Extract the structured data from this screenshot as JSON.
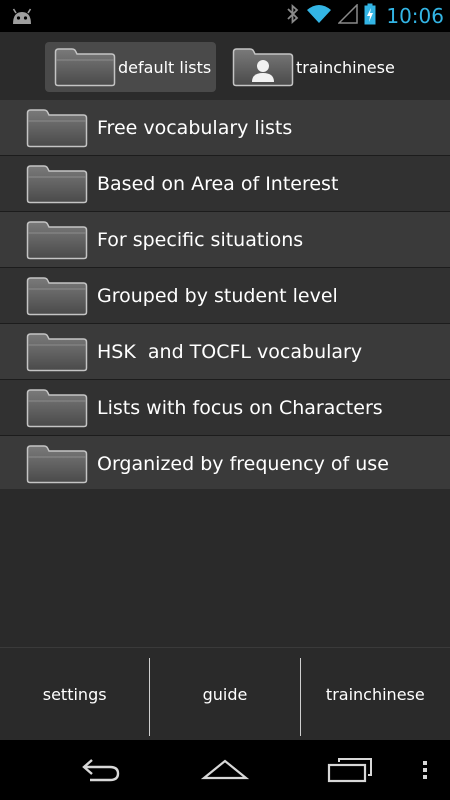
{
  "status_bar": {
    "time": "10:06",
    "icons": [
      "android-icon",
      "bluetooth-icon",
      "wifi-icon",
      "signal-icon",
      "battery-charging-icon"
    ],
    "accent": "#33b5e5"
  },
  "tabs": [
    {
      "label": "default lists",
      "icon": "folder-icon",
      "active": true
    },
    {
      "label": "trainchinese",
      "icon": "user-folder-icon",
      "active": false
    }
  ],
  "list": {
    "items": [
      {
        "label": "Free vocabulary lists"
      },
      {
        "label": "Based on Area of Interest"
      },
      {
        "label": "For specific situations"
      },
      {
        "label": "Grouped by student level"
      },
      {
        "label": "HSK  and TOCFL vocabulary"
      },
      {
        "label": "Lists with focus on Characters"
      },
      {
        "label": "Organized by frequency of use"
      }
    ]
  },
  "bottom_bar": {
    "settings": "settings",
    "guide": "guide",
    "trainchinese": "trainchinese"
  },
  "nav_bar": {
    "icons": [
      "back-icon",
      "home-icon",
      "recent-apps-icon",
      "menu-icon"
    ]
  }
}
